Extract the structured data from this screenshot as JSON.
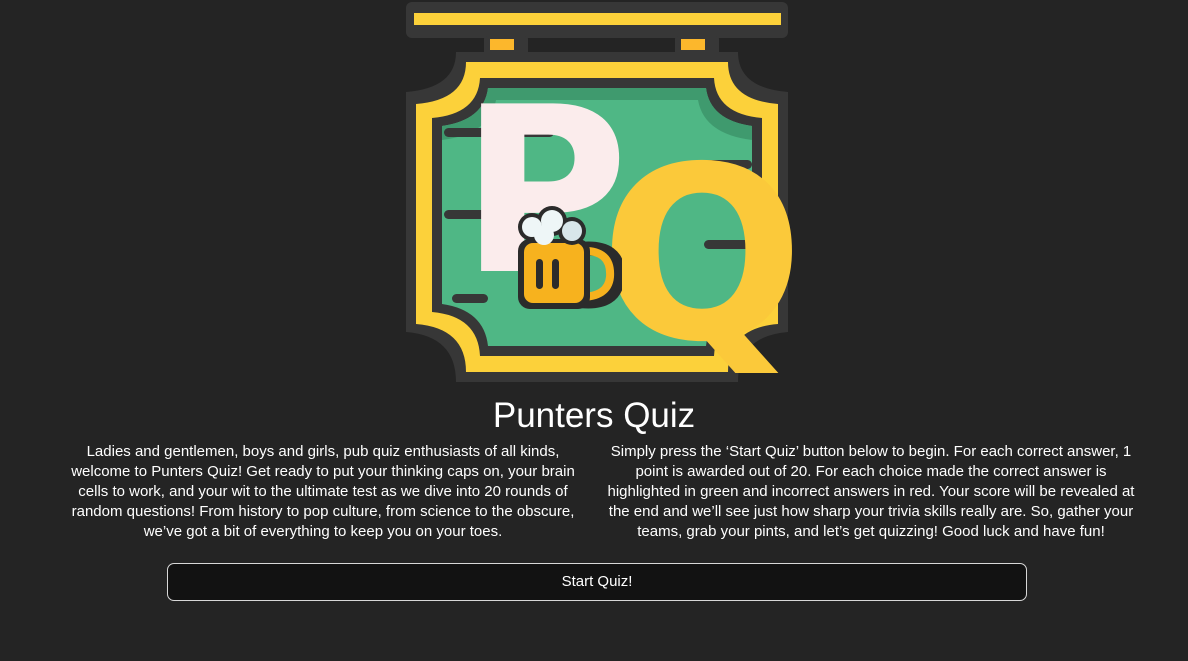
{
  "logo": {
    "letter_p": "P",
    "letter_q": "Q",
    "icon": "beer-mug-icon",
    "colors": {
      "board_green": "#4fb785",
      "frame_yellow": "#fcd13a",
      "frame_dark": "#373737",
      "letter_p": "#fbecec",
      "letter_q": "#fbc93a"
    }
  },
  "header": {
    "title": "Punters Quiz"
  },
  "intro": {
    "left": "Ladies and gentlemen, boys and girls, pub quiz enthusiasts of all kinds, welcome to Punters Quiz! Get ready to put your thinking caps on, your brain cells to work, and your wit to the ultimate test as we dive into 20 rounds of random questions! From history to pop culture, from science to the obscure, we’ve got a bit of everything to keep you on your toes.",
    "right": "Simply press the ‘Start Quiz’ button below to begin. For each correct answer, 1 point is awarded out of 20. For each choice made the correct answer is highlighted in green and incorrect answers in red. Your score will be revealed at the end and we’ll see just how sharp your trivia skills really are. So, gather your teams, grab your pints, and let’s get quizzing! Good luck and have fun!"
  },
  "actions": {
    "start_label": "Start Quiz!"
  },
  "theme": {
    "background": "#242424",
    "button_background": "#121212",
    "button_border": "#d8d8d8",
    "text": "#ffffff"
  }
}
